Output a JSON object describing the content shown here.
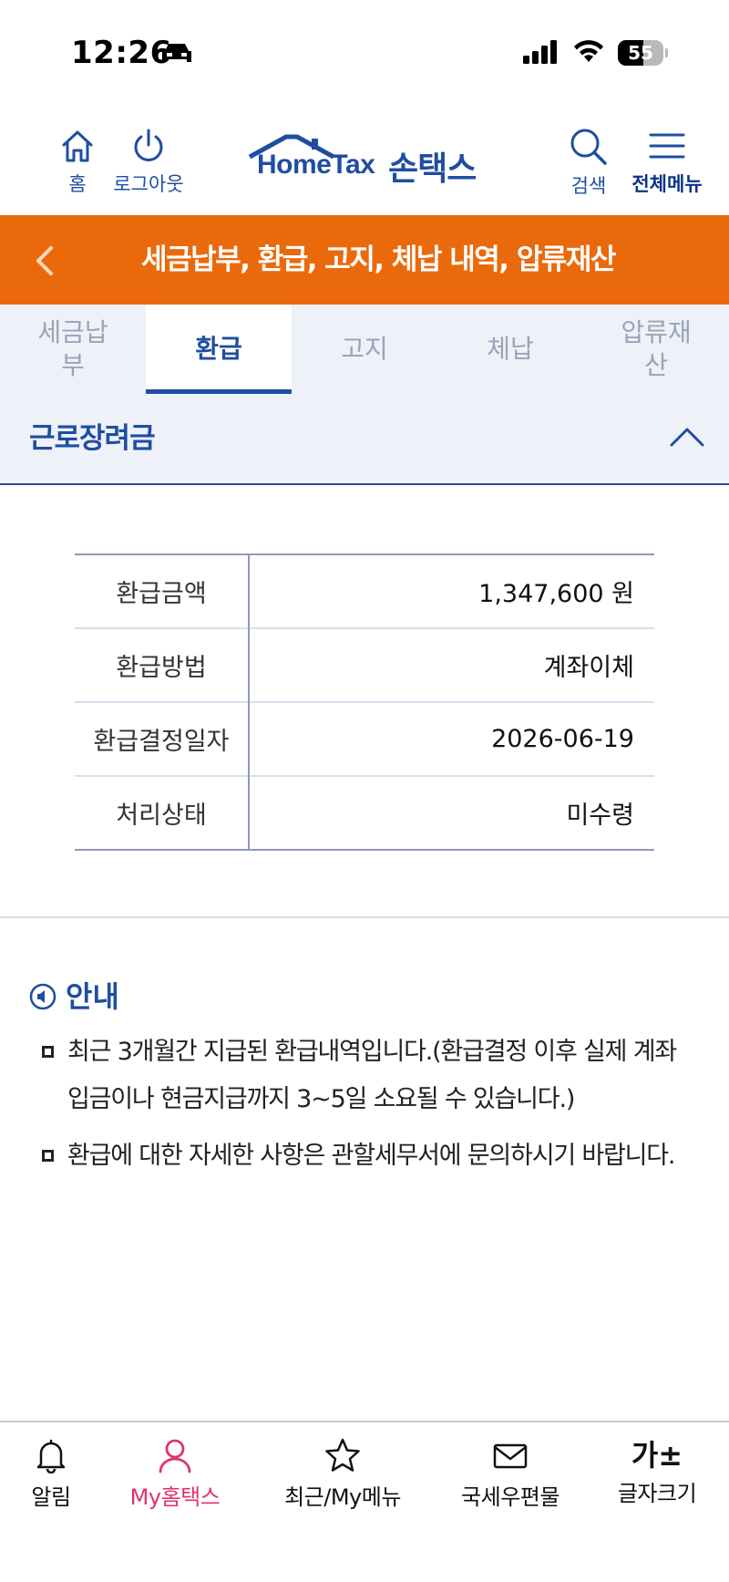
{
  "status_bar": {
    "time": "12:26",
    "battery_percent": "55"
  },
  "header": {
    "home_label": "홈",
    "logout_label": "로그아웃",
    "logo_text": "HomeTax",
    "logo_brand": "손택스",
    "search_label": "검색",
    "menu_label": "전체메뉴"
  },
  "title_bar": {
    "title": "세금납부, 환급, 고지, 체납 내역, 압류재산"
  },
  "tabs": [
    {
      "label": "세금납부",
      "active": false
    },
    {
      "label": "환급",
      "active": true
    },
    {
      "label": "고지",
      "active": false
    },
    {
      "label": "체납",
      "active": false
    },
    {
      "label": "압류재산",
      "active": false
    }
  ],
  "section": {
    "title": "근로장려금"
  },
  "refund_table": [
    {
      "label": "환급금액",
      "value": "1,347,600 원"
    },
    {
      "label": "환급방법",
      "value": "계좌이체"
    },
    {
      "label": "환급결정일자",
      "value": "2026-06-19"
    },
    {
      "label": "처리상태",
      "value": "미수령"
    }
  ],
  "notice": {
    "title": "안내",
    "items": [
      "최근 3개월간 지급된 환급내역입니다.(환급결정 이후 실제 계좌 입금이나 현금지급까지 3~5일 소요될 수 있습니다.)",
      "환급에 대한 자세한 사항은 관할세무서에 문의하시기 바랍니다."
    ]
  },
  "bottom_nav": [
    {
      "label": "알림"
    },
    {
      "label": "My홈택스"
    },
    {
      "label": "최근/My메뉴"
    },
    {
      "label": "국세우편물"
    },
    {
      "label": "글자크기"
    }
  ],
  "colors": {
    "primary": "#1f4ea1",
    "accent": "#ea6a0b",
    "active_nav": "#e0336b"
  }
}
